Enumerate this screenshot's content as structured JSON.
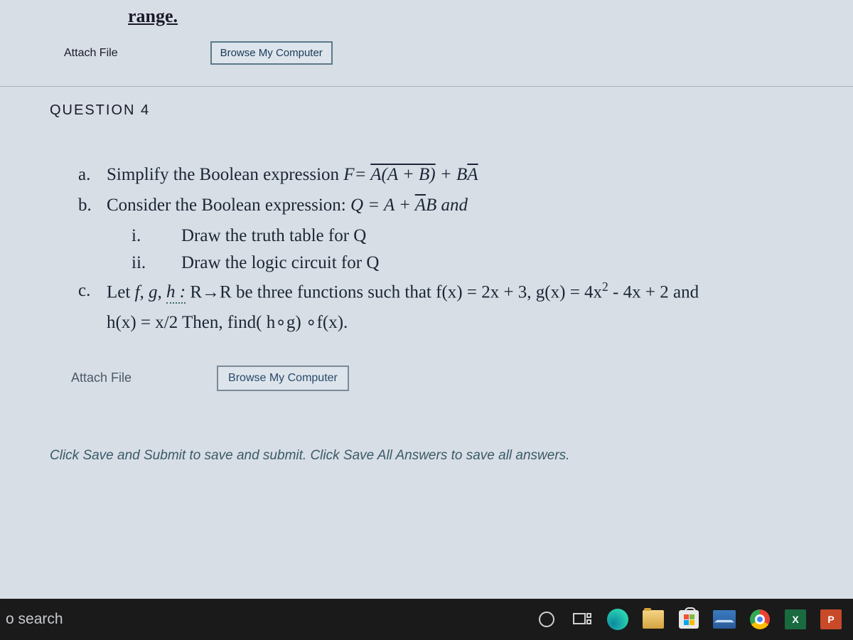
{
  "page_top": {
    "range_label": "range.",
    "attach_label": "Attach File",
    "browse_label": "Browse My Computer"
  },
  "question": {
    "header": "QUESTION 4",
    "items": {
      "a": {
        "letter": "a.",
        "text_before": "Simplify the Boolean expression ",
        "F_eq": "F= ",
        "overline1": "A(A + B)",
        "plus": " + B",
        "overline2": "A"
      },
      "b": {
        "letter": "b.",
        "text_before": "Consider the Boolean expression:  ",
        "Q_eq": "Q = A + ",
        "overline1": "A",
        "tail": "B and",
        "sub_i": {
          "roman": "i.",
          "text": "Draw the truth table for Q"
        },
        "sub_ii": {
          "roman": "ii.",
          "text": "Draw the logic circuit for Q"
        }
      },
      "c": {
        "letter": "c.",
        "text_1": "Let ",
        "fg": "f, g, ",
        "h": "h :",
        "text_2": "R→R be three functions such that f(x) = 2x + 3, g(x) = 4x",
        "squared": "2",
        "text_3": " - 4x + 2 and",
        "line2": "h(x) = x/2 Then, find( h∘g) ∘f(x)."
      }
    },
    "attach_label": "Attach File",
    "browse_label": "Browse My Computer"
  },
  "footer_note": "Click Save and Submit to save and submit. Click Save All Answers to save all answers.",
  "taskbar": {
    "search": "o search",
    "excel_label": "X",
    "ppt_label": "P"
  }
}
